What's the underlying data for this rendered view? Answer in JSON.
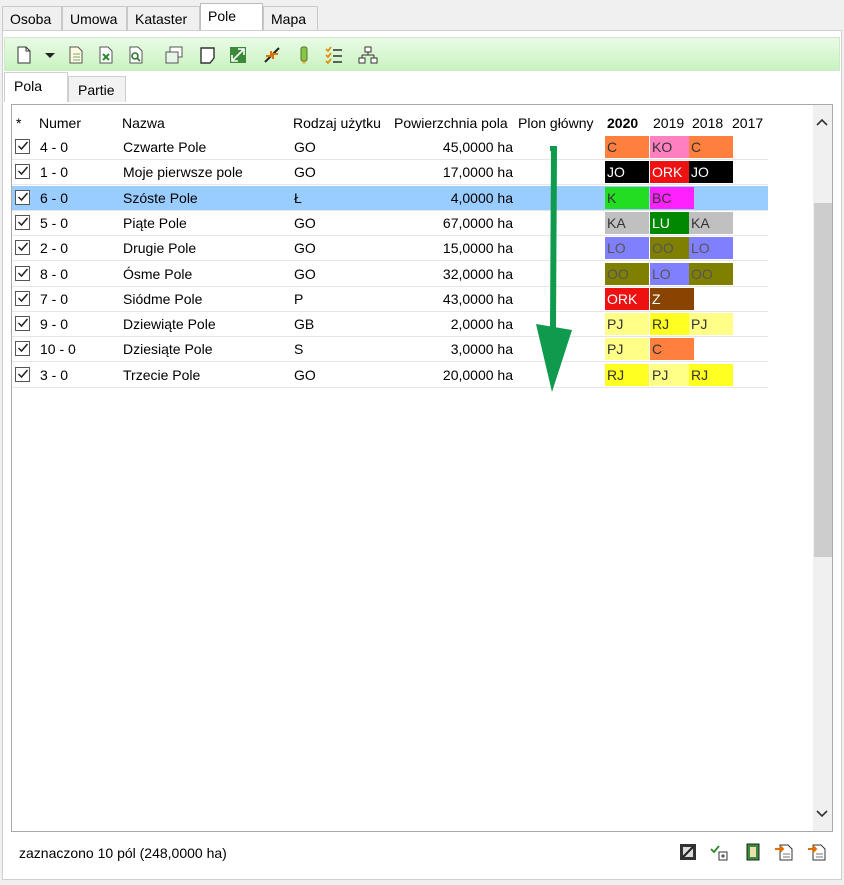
{
  "top_tabs": [
    "Osoba",
    "Umowa",
    "Kataster",
    "Pole",
    "Mapa"
  ],
  "active_top_tab": "Pole",
  "toolbar_icons": [
    "new-document-icon",
    "dropdown-arrow-icon",
    "document-icon",
    "document-delete-icon",
    "document-search-icon",
    "copy-icon",
    "page-icon",
    "expand-icon",
    "collapse-icon",
    "pencil-icon",
    "checklist-icon",
    "hierarchy-icon"
  ],
  "sub_tabs": [
    "Pola",
    "Partie"
  ],
  "active_sub_tab": "Pola",
  "columns": {
    "star": "*",
    "numer": "Numer",
    "nazwa": "Nazwa",
    "rodzaj": "Rodzaj użytku",
    "powierzchnia": "Powierzchnia pola",
    "plon": "Plon główny",
    "y2020": "2020",
    "y2019": "2019",
    "y2018": "2018",
    "y2017": "2017"
  },
  "rows": [
    {
      "numer": "4 - 0",
      "nazwa": "Czwarte Pole",
      "rodzaj": "GO",
      "pow": "45,0000 ha",
      "crops": [
        {
          "t": "C",
          "bg": "#ff7f3f",
          "fg": "#333333"
        },
        {
          "t": "KO",
          "bg": "#ff80c0",
          "fg": "#333333"
        },
        {
          "t": "C",
          "bg": "#ff7f3f",
          "fg": "#333333"
        }
      ]
    },
    {
      "numer": "1 - 0",
      "nazwa": "Moje pierwsze pole",
      "rodzaj": "GO",
      "pow": "17,0000 ha",
      "crops": [
        {
          "t": "JO",
          "bg": "#000000",
          "fg": "#ffffff"
        },
        {
          "t": "ORK",
          "bg": "#ee1111",
          "fg": "#ffffff"
        },
        {
          "t": "JO",
          "bg": "#000000",
          "fg": "#ffffff"
        }
      ]
    },
    {
      "numer": "6 - 0",
      "nazwa": "Szóste Pole",
      "rodzaj": "Ł",
      "pow": "4,0000 ha",
      "selected": true,
      "crops": [
        {
          "t": "K",
          "bg": "#22dd22",
          "fg": "#333333"
        },
        {
          "t": "BC",
          "bg": "#ff22ff",
          "fg": "#333333"
        },
        null
      ]
    },
    {
      "numer": "5 - 0",
      "nazwa": "Piąte Pole",
      "rodzaj": "GO",
      "pow": "67,0000 ha",
      "crops": [
        {
          "t": "KA",
          "bg": "#c0c0c0",
          "fg": "#333333"
        },
        {
          "t": "LU",
          "bg": "#008800",
          "fg": "#ffffff"
        },
        {
          "t": "KA",
          "bg": "#c0c0c0",
          "fg": "#333333"
        }
      ]
    },
    {
      "numer": "2 - 0",
      "nazwa": "Drugie Pole",
      "rodzaj": "GO",
      "pow": "15,0000 ha",
      "crops": [
        {
          "t": "LO",
          "bg": "#8080ff",
          "fg": "#555555"
        },
        {
          "t": "OO",
          "bg": "#808000",
          "fg": "#555555"
        },
        {
          "t": "LO",
          "bg": "#8080ff",
          "fg": "#555555"
        }
      ]
    },
    {
      "numer": "8 - 0",
      "nazwa": "Ósme Pole",
      "rodzaj": "GO",
      "pow": "32,0000 ha",
      "crops": [
        {
          "t": "OO",
          "bg": "#808000",
          "fg": "#555555"
        },
        {
          "t": "LO",
          "bg": "#8080ff",
          "fg": "#555555"
        },
        {
          "t": "OO",
          "bg": "#808000",
          "fg": "#555555"
        }
      ]
    },
    {
      "numer": "7 - 0",
      "nazwa": "Siódme Pole",
      "rodzaj": "P",
      "pow": "43,0000 ha",
      "crops": [
        {
          "t": "ORK",
          "bg": "#ee1111",
          "fg": "#ffffff"
        },
        {
          "t": "Z",
          "bg": "#884400",
          "fg": "#ffffff"
        },
        null
      ]
    },
    {
      "numer": "9 - 0",
      "nazwa": "Dziewiąte Pole",
      "rodzaj": "GB",
      "pow": "2,0000 ha",
      "crops": [
        {
          "t": "PJ",
          "bg": "#ffff88",
          "fg": "#333333"
        },
        {
          "t": "RJ",
          "bg": "#ffff22",
          "fg": "#333333"
        },
        {
          "t": "PJ",
          "bg": "#ffff88",
          "fg": "#333333"
        }
      ]
    },
    {
      "numer": "10 - 0",
      "nazwa": "Dziesiąte Pole",
      "rodzaj": "S",
      "pow": "3,0000 ha",
      "crops": [
        {
          "t": "PJ",
          "bg": "#ffff88",
          "fg": "#333333"
        },
        {
          "t": "C",
          "bg": "#ff7f3f",
          "fg": "#333333"
        },
        null
      ]
    },
    {
      "numer": "3 - 0",
      "nazwa": "Trzecie Pole",
      "rodzaj": "GO",
      "pow": "20,0000 ha",
      "crops": [
        {
          "t": "RJ",
          "bg": "#ffff22",
          "fg": "#333333"
        },
        {
          "t": "PJ",
          "bg": "#ffff88",
          "fg": "#333333"
        },
        {
          "t": "RJ",
          "bg": "#ffff22",
          "fg": "#333333"
        }
      ]
    }
  ],
  "status_text": "zaznaczono 10 pól (248,0000 ha)",
  "bottom_icons": [
    "export-icon",
    "settings-icon",
    "book-icon",
    "import-icon",
    "import-all-icon"
  ],
  "colors": {
    "accent_arrow": "#0f9a4e",
    "selection": "#99ccff",
    "toolbar": "#c9f3c1"
  }
}
